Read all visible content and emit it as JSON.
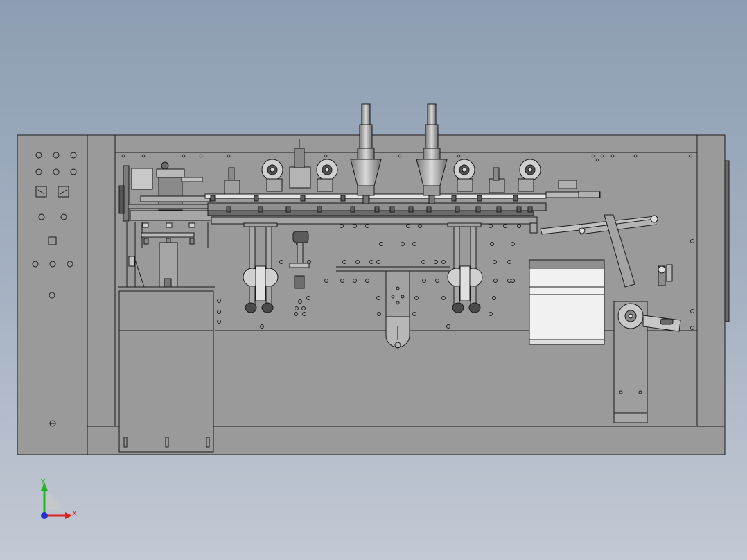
{
  "viewport": {
    "background_top": "#8d9db3",
    "background_bottom": "#c3c9d4"
  },
  "model": {
    "body_fill": "#9a9a9a",
    "line_color": "#1a1a1a",
    "light_part_fill": "#ececec",
    "dark_part_fill": "#5a5a5a"
  },
  "triad": {
    "y_label": "Y",
    "x_label": "X",
    "y_color": "#1fb51f",
    "x_color": "#e02020",
    "z_color": "#2030d0"
  }
}
